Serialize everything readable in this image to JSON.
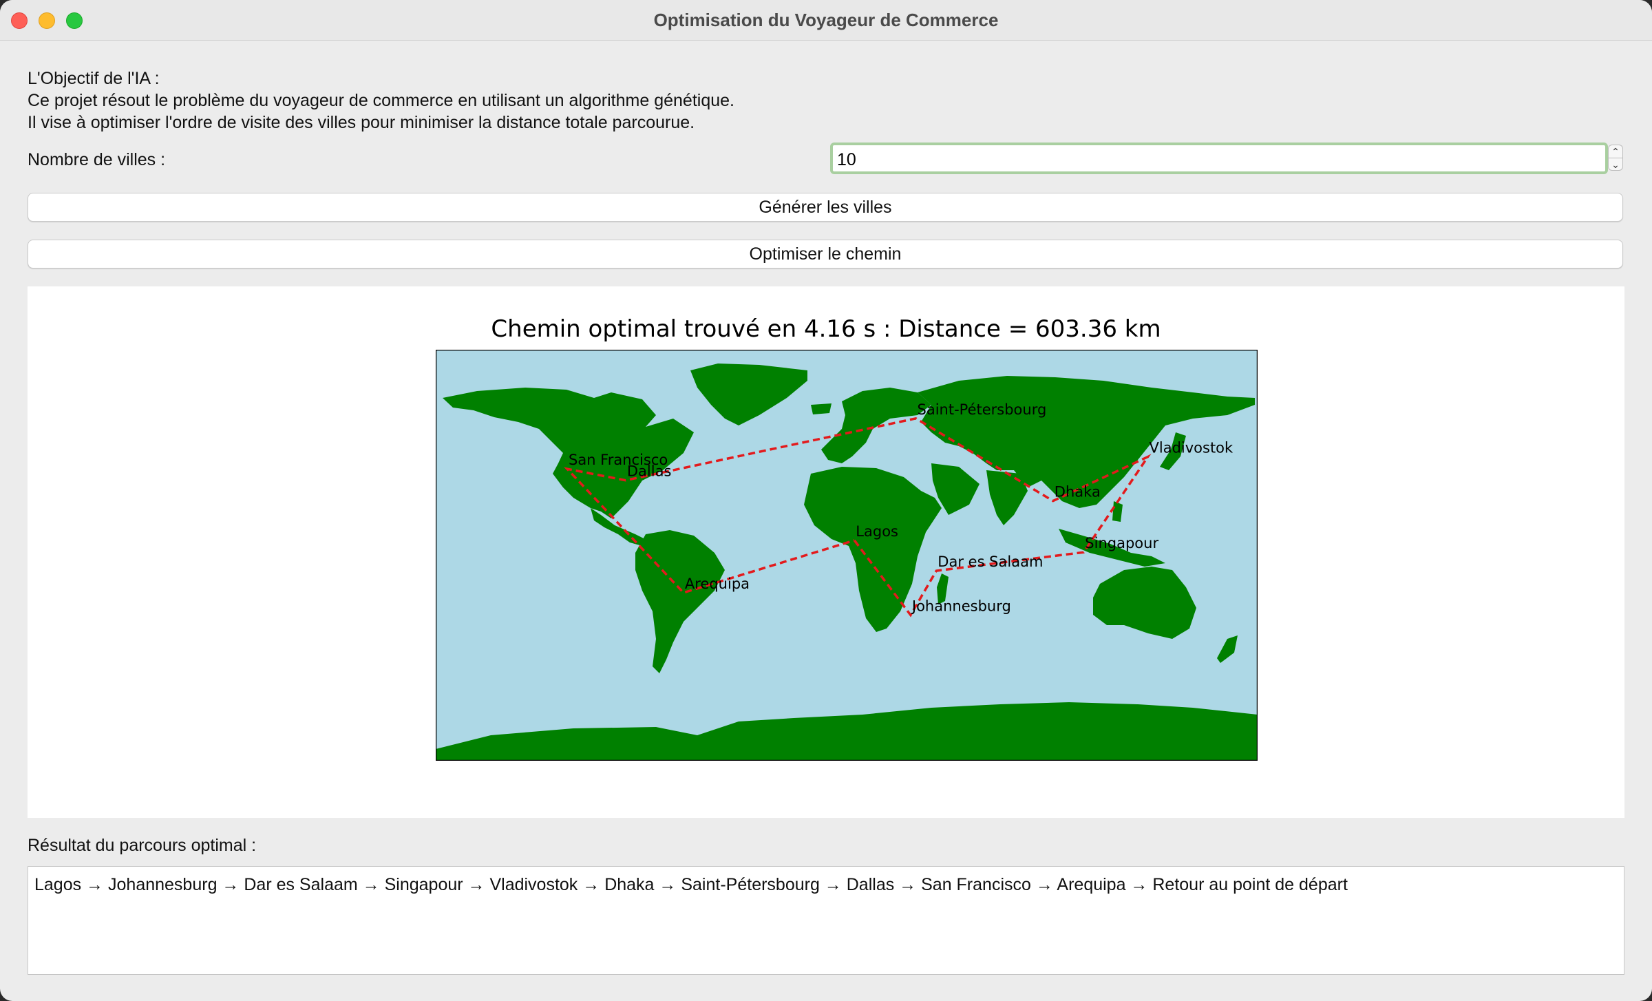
{
  "window": {
    "title": "Optimisation du Voyageur de Commerce"
  },
  "intro": {
    "heading": "L'Objectif de l'IA :",
    "line1": "Ce projet résout le problème du voyageur de commerce en utilisant un algorithme génétique.",
    "line2": "Il vise à optimiser l'ordre de visite des villes pour minimiser la distance totale parcourue."
  },
  "controls": {
    "cities_label": "Nombre de villes :",
    "cities_value": "10",
    "generate_label": "Générer les villes",
    "optimize_label": "Optimiser le chemin"
  },
  "colors": {
    "ocean": "#add8e6",
    "land": "#008000",
    "route": "#e31a1c",
    "input_focus": "#a9cfa0"
  },
  "chart_data": {
    "type": "map",
    "title": "Chemin optimal trouvé en 4.16 s : Distance = 603.36 km",
    "cities": [
      {
        "name": "San Francisco",
        "lon": -122.4,
        "lat": 37.8
      },
      {
        "name": "Dallas",
        "lon": -96.8,
        "lat": 32.8
      },
      {
        "name": "Saint-Pétersbourg",
        "lon": 30.3,
        "lat": 59.9
      },
      {
        "name": "Vladivostok",
        "lon": 131.9,
        "lat": 43.1
      },
      {
        "name": "Dhaka",
        "lon": 90.4,
        "lat": 23.8
      },
      {
        "name": "Singapour",
        "lon": 103.8,
        "lat": 1.3
      },
      {
        "name": "Lagos",
        "lon": 3.4,
        "lat": 6.5
      },
      {
        "name": "Dar es Salaam",
        "lon": 39.3,
        "lat": -6.8
      },
      {
        "name": "Johannesburg",
        "lon": 28.0,
        "lat": -26.2
      },
      {
        "name": "Arequipa",
        "lon": -71.5,
        "lat": -16.4
      }
    ],
    "route": [
      "Lagos",
      "Johannesburg",
      "Dar es Salaam",
      "Singapour",
      "Vladivostok",
      "Dhaka",
      "Saint-Pétersbourg",
      "Dallas",
      "San Francisco",
      "Arequipa",
      "Lagos"
    ],
    "xlim": [
      -180,
      180
    ],
    "ylim": [
      -90,
      90
    ]
  },
  "result": {
    "label": "Résultat du parcours optimal :",
    "text": "Lagos → Johannesburg → Dar es Salaam → Singapour → Vladivostok → Dhaka → Saint-Pétersbourg → Dallas → San Francisco → Arequipa → Retour au point de départ"
  }
}
